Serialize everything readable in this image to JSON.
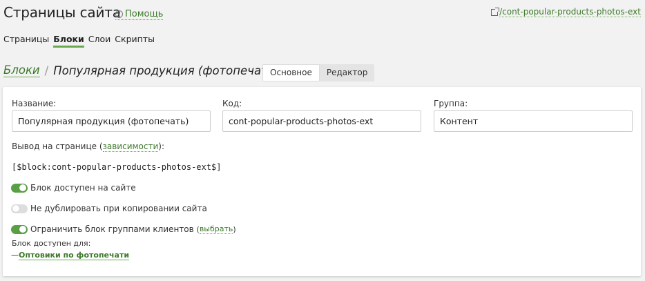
{
  "header": {
    "title": "Страницы сайта",
    "help_label": "Помощь",
    "ext_link": "/cont-popular-products-photos-ext"
  },
  "tabs": [
    {
      "label": "Страницы",
      "active": false
    },
    {
      "label": "Блоки",
      "active": true
    },
    {
      "label": "Слои",
      "active": false
    },
    {
      "label": "Скрипты",
      "active": false
    }
  ],
  "breadcrumb": {
    "parent": "Блоки",
    "separator": "/",
    "current": "Популярная продукция (фотопечать)"
  },
  "modes": [
    {
      "label": "Основное",
      "active": true
    },
    {
      "label": "Редактор",
      "active": false
    }
  ],
  "form": {
    "name_label": "Название:",
    "name_value": "Популярная продукция (фотопечать)",
    "code_label": "Код:",
    "code_value": "cont-popular-products-photos-ext",
    "group_label": "Группа:",
    "group_value": "Контент",
    "output_prefix": "Вывод на странице (",
    "output_link": "зависимости",
    "output_suffix": "):",
    "code_snippet": "[$block:cont-popular-products-photos-ext$]",
    "toggle_available": "Блок доступен на сайте",
    "toggle_available_on": true,
    "toggle_nodup": "Не дублировать при копировании сайта",
    "toggle_nodup_on": false,
    "toggle_restrict": "Ограничить блок группами клиентов",
    "toggle_restrict_on": true,
    "choose_prefix": "(",
    "choose_link": "выбрать",
    "choose_suffix": ")",
    "available_for": "Блок доступен для:",
    "group_dash": "—",
    "group_item": "Оптовики по фотопечати"
  },
  "colors": {
    "accent": "#6aa84f",
    "link": "#3d7a2a",
    "background": "#f2f2f2"
  },
  "icons": {
    "help": "question-circle-icon",
    "external": "external-link-icon"
  }
}
